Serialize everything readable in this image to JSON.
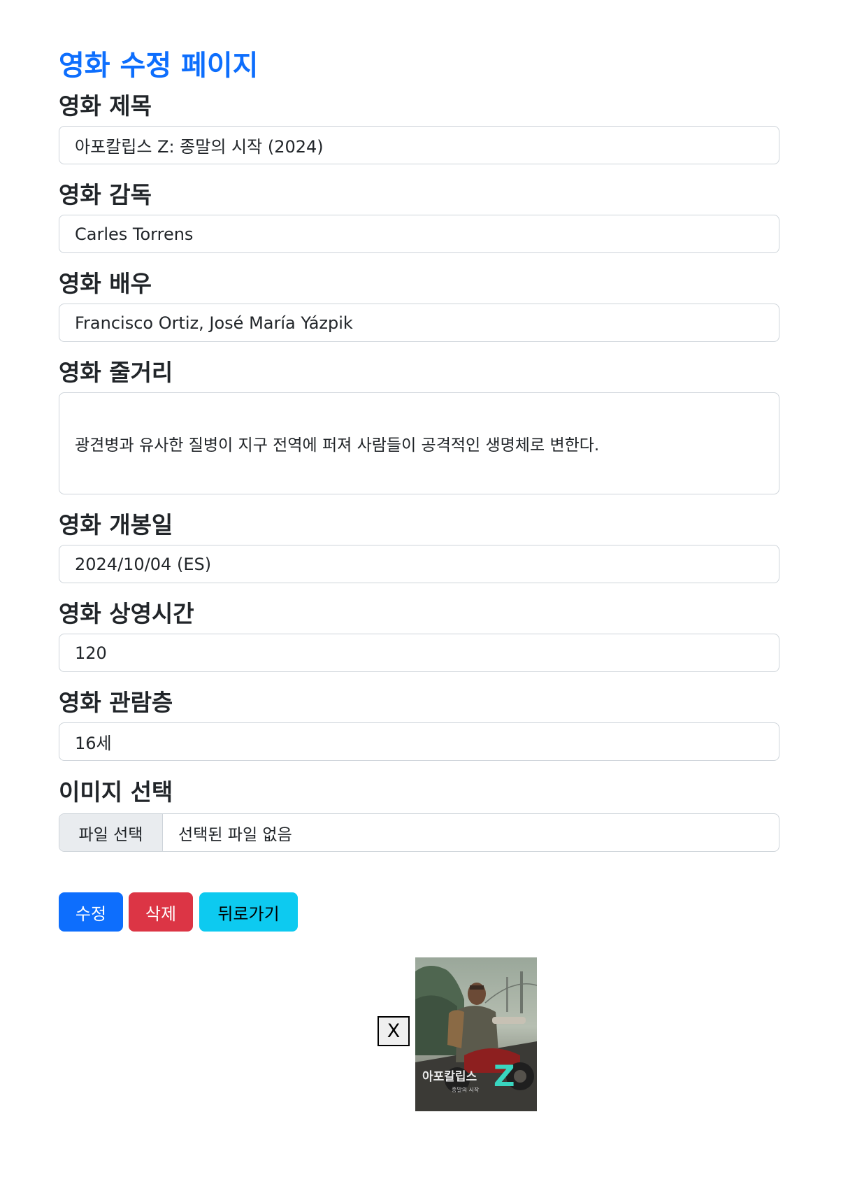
{
  "page": {
    "title": "영화 수정 페이지"
  },
  "fields": {
    "title": {
      "label": "영화 제목",
      "value": "아포칼립스 Z: 종말의 시작 (2024)"
    },
    "director": {
      "label": "영화 감독",
      "value": "Carles Torrens"
    },
    "actors": {
      "label": "영화 배우",
      "value": "Francisco Ortiz, José María Yázpik"
    },
    "plot": {
      "label": "영화 줄거리",
      "value": "광견병과 유사한 질병이 지구 전역에 퍼져 사람들이 공격적인 생명체로 변한다."
    },
    "release": {
      "label": "영화 개봉일",
      "value": "2024/10/04 (ES)"
    },
    "runtime": {
      "label": "영화 상영시간",
      "value": "120"
    },
    "rating": {
      "label": "영화 관람층",
      "value": "16세"
    }
  },
  "image_select": {
    "label": "이미지 선택",
    "button_label": "파일 선택",
    "status": "선택된 파일 없음"
  },
  "buttons": {
    "edit": "수정",
    "delete": "삭제",
    "back": "뒤로가기"
  },
  "preview": {
    "close_label": "X",
    "poster_title": "아포칼립스",
    "poster_letter": "Z",
    "poster_subtitle": "종말의 시작"
  },
  "colors": {
    "primary": "#0d6efd",
    "danger": "#dc3545",
    "info": "#0dcaf0"
  }
}
